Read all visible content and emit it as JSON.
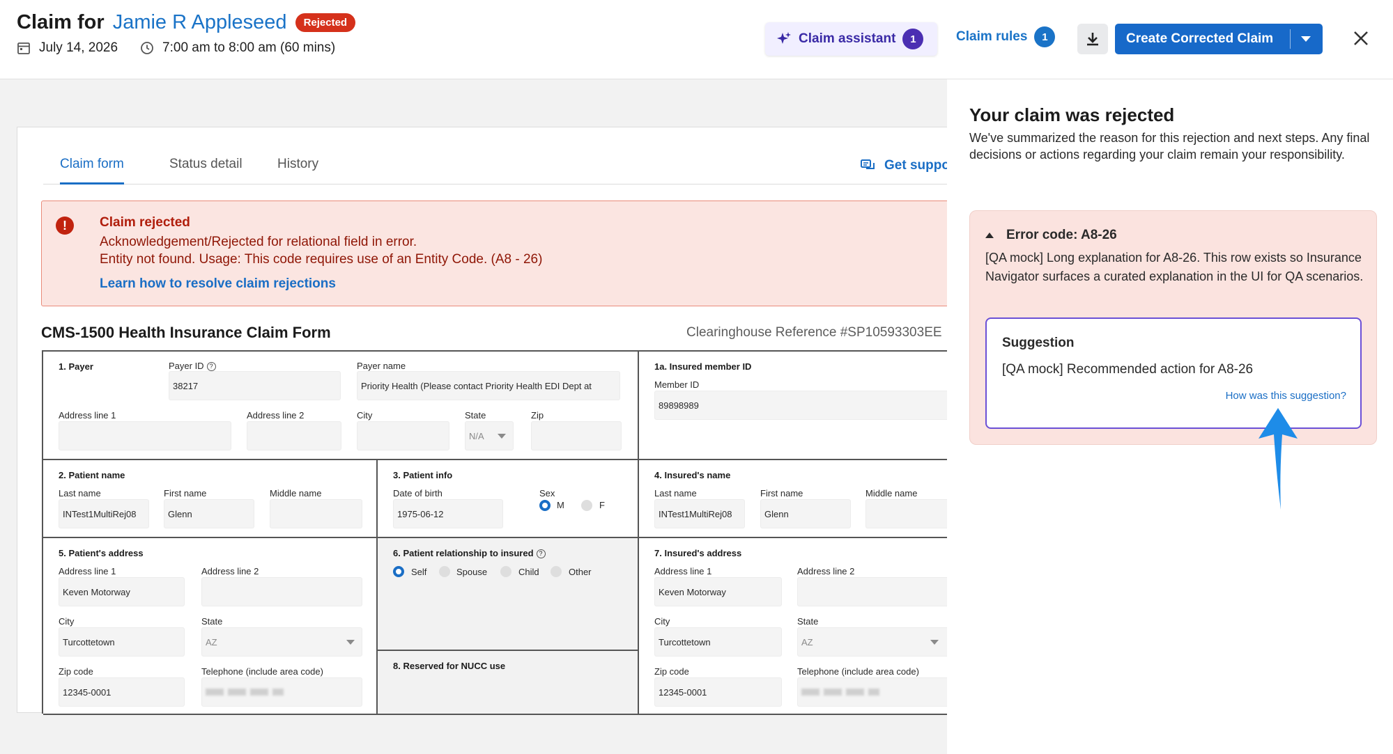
{
  "header": {
    "title_prefix": "Claim for",
    "patient_name": "Jamie R Appleseed",
    "status": "Rejected",
    "date": "July 14, 2026",
    "time": "7:00 am to 8:00 am (60 mins)",
    "assistant_label": "Claim assistant",
    "assistant_count": "1",
    "rules_label": "Claim rules",
    "rules_count": "1",
    "create_label": "Create Corrected Claim"
  },
  "tabs": [
    {
      "label": "Claim form",
      "active": true
    },
    {
      "label": "Status detail",
      "active": false
    },
    {
      "label": "History",
      "active": false
    }
  ],
  "support_label": "Get support",
  "error_banner": {
    "title": "Claim rejected",
    "line1": "Acknowledgement/Rejected for relational field in error.",
    "line2": "Entity not found. Usage: This code requires use of an Entity Code. (A8 - 26)",
    "link": "Learn how to resolve claim rejections"
  },
  "form": {
    "title": "CMS-1500 Health Insurance Claim Form",
    "reference": "Clearinghouse Reference #SP10593303EE",
    "payer": {
      "title": "1. Payer",
      "payer_id_label": "Payer ID",
      "payer_id": "38217",
      "payer_name_label": "Payer name",
      "payer_name": "Priority Health (Please contact Priority Health EDI Dept at",
      "addr1_label": "Address line 1",
      "addr2_label": "Address line 2",
      "city_label": "City",
      "state_label": "State",
      "state": "N/A",
      "zip_label": "Zip"
    },
    "insured_id": {
      "title": "1a. Insured member ID",
      "member_label": "Member ID",
      "member_id": "89898989"
    },
    "patient_name": {
      "title": "2. Patient name",
      "last_label": "Last name",
      "last": "INTest1MultiRej08",
      "first_label": "First name",
      "first": "Glenn",
      "middle_label": "Middle name"
    },
    "patient_info": {
      "title": "3. Patient info",
      "dob_label": "Date of birth",
      "dob": "1975-06-12",
      "sex_label": "Sex",
      "male": "M",
      "female": "F"
    },
    "insured_name": {
      "title": "4. Insured's name",
      "last_label": "Last name",
      "last": "INTest1MultiRej08",
      "first_label": "First name",
      "first": "Glenn",
      "middle_label": "Middle name"
    },
    "patient_address": {
      "title": "5. Patient's address",
      "addr1_label": "Address line 1",
      "addr1": "Keven Motorway",
      "addr2_label": "Address line 2",
      "city_label": "City",
      "city": "Turcottetown",
      "state_label": "State",
      "state": "AZ",
      "zip_label": "Zip code",
      "zip": "12345-0001",
      "phone_label": "Telephone (include area code)"
    },
    "relationship": {
      "title": "6. Patient relationship to insured",
      "options": [
        "Self",
        "Spouse",
        "Child",
        "Other"
      ]
    },
    "reserved": {
      "title": "8. Reserved for NUCC use"
    },
    "insured_address": {
      "title": "7. Insured's address",
      "addr1_label": "Address line 1",
      "addr1": "Keven Motorway",
      "addr2_label": "Address line 2",
      "city_label": "City",
      "city": "Turcottetown",
      "state_label": "State",
      "state": "AZ",
      "zip_label": "Zip code",
      "zip": "12345-0001",
      "phone_label": "Telephone (include area code)"
    }
  },
  "side_panel": {
    "title": "Your claim was rejected",
    "description": "We've summarized the reason for this rejection and next steps. Any final decisions or actions regarding your claim remain your responsibility.",
    "error_code": "Error code: A8-26",
    "explanation": "[QA mock] Long explanation for A8-26. This row exists so Insurance Navigator surfaces a curated explanation in the UI for QA scenarios.",
    "suggestion_title": "Suggestion",
    "suggestion_text": "[QA mock] Recommended action for A8-26",
    "feedback_link": "How was this suggestion?"
  },
  "colors": {
    "primary": "#1769c9",
    "danger": "#d5311b",
    "assistant": "#4b2fb2",
    "arrow": "#1e8ce8"
  }
}
